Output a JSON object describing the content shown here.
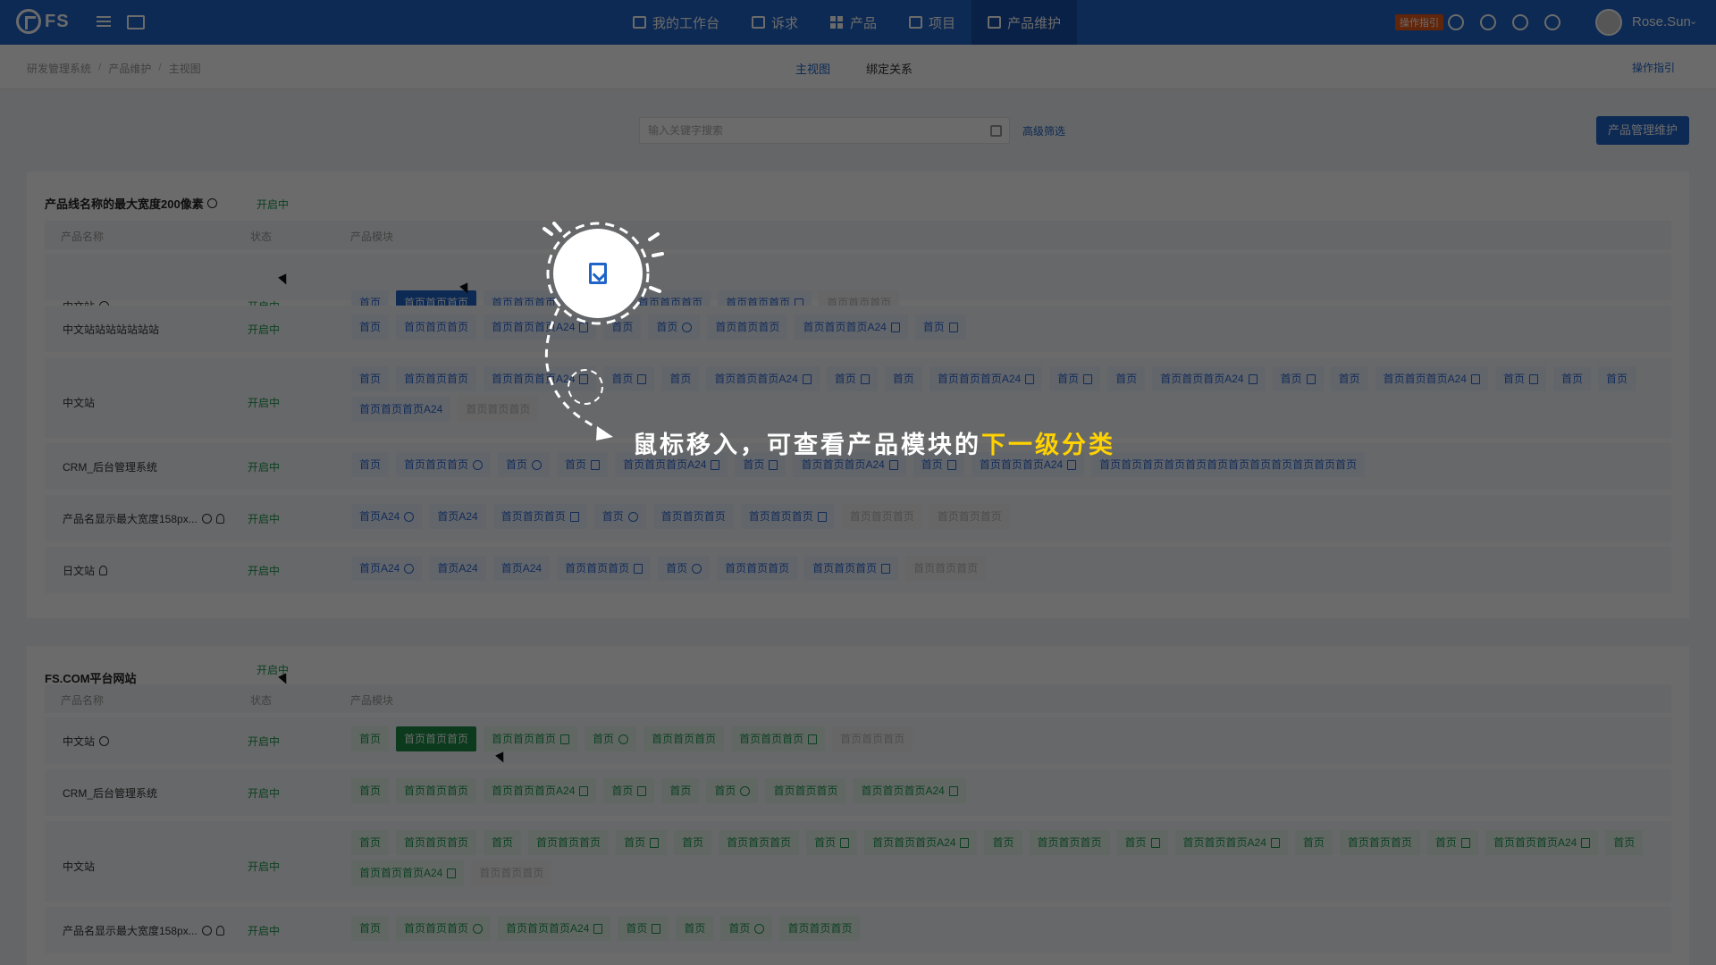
{
  "header": {
    "logo_text": "FS",
    "nav": [
      {
        "label": "我的工作台",
        "icon": "monitor-icon"
      },
      {
        "label": "诉求",
        "icon": "inbox-icon"
      },
      {
        "label": "产品",
        "icon": "grid-icon"
      },
      {
        "label": "项目",
        "icon": "briefcase-icon"
      },
      {
        "label": "产品维护",
        "icon": "plus-square-icon"
      }
    ],
    "guide_badge": "操作指引",
    "user_name": "Rose.Sun",
    "caret": "⌄"
  },
  "subheader": {
    "breadcrumb": [
      "研发管理系统",
      "产品维护",
      "主视图"
    ],
    "view_tabs": [
      "主视图",
      "绑定关系"
    ],
    "op_guide": "操作指引"
  },
  "search": {
    "placeholder": "输入关键字搜索",
    "advanced": "高级筛选",
    "primary_button": "产品管理维护"
  },
  "table_headers": {
    "name": "产品名称",
    "status": "状态",
    "modules": "产品模块"
  },
  "cards": [
    {
      "title": "产品线名称的最大宽度200像素",
      "status": "开启中",
      "rows": [
        {
          "name": "中文站",
          "status": "开启中",
          "modules": [
            "首页",
            "首页首页首页",
            "首页首页首页",
            "首页",
            "首页首页首页",
            "首页首页首页",
            "首页首页首页"
          ]
        },
        {
          "name": "中文站站站站站站站",
          "status": "开启中",
          "modules": [
            "首页",
            "首页首页首页",
            "首页首页首页A24",
            "首页",
            "首页",
            "首页首页首页",
            "首页首页首页A24",
            "首页"
          ]
        },
        {
          "name": "中文站",
          "status": "开启中",
          "modules": [
            "首页",
            "首页首页首页",
            "首页首页首页A24",
            "首页",
            "首页",
            "首页首页首页A24",
            "首页",
            "首页",
            "首页首页首页A24",
            "首页",
            "首页",
            "首页首页首页A24",
            "首页",
            "首页",
            "首页首页首页A24",
            "首页",
            "首页",
            "首页",
            "首页首页首页A24",
            "首页首页首页"
          ]
        },
        {
          "name": "CRM_后台管理系统",
          "status": "开启中",
          "modules": [
            "首页",
            "首页首页首页",
            "首页",
            "首页",
            "首页首页首页A24",
            "首页",
            "首页首页首页A24",
            "首页",
            "首页首页首页A24",
            "首页首页首页首页首页首页首页首页首页首页首页首页"
          ]
        },
        {
          "name": "产品名显示最大宽度158px...",
          "status": "开启中",
          "modules": [
            "首页A24",
            "首页A24",
            "首页首页首页",
            "首页",
            "首页首页首页",
            "首页首页首页",
            "首页首页首页",
            "首页首页首页"
          ]
        },
        {
          "name": "日文站",
          "status": "开启中",
          "modules": [
            "首页A24",
            "首页A24",
            "首页A24",
            "首页首页首页",
            "首页",
            "首页首页首页",
            "首页首页首页",
            "首页首页首页"
          ]
        }
      ]
    },
    {
      "title": "FS.COM平台网站",
      "status": "开启中",
      "rows": [
        {
          "name": "中文站",
          "status": "开启中",
          "modules": [
            "首页",
            "首页首页首页",
            "首页首页首页",
            "首页",
            "首页首页首页",
            "首页首页首页",
            "首页首页首页"
          ]
        },
        {
          "name": "CRM_后台管理系统",
          "status": "开启中",
          "modules": [
            "首页",
            "首页首页首页",
            "首页首页首页A24",
            "首页",
            "首页",
            "首页",
            "首页首页首页",
            "首页首页首页A24"
          ]
        },
        {
          "name": "中文站",
          "status": "开启中",
          "modules": [
            "首页",
            "首页首页首页",
            "首页",
            "首页首页首页",
            "首页",
            "首页",
            "首页首页首页",
            "首页",
            "首页首页首页A24",
            "首页",
            "首页首页首页",
            "首页",
            "首页首页首页A24",
            "首页",
            "首页首页首页",
            "首页",
            "首页首页首页A24",
            "首页",
            "首页首页首页A24",
            "首页首页首页"
          ]
        },
        {
          "name": "产品名显示最大宽度158px...",
          "status": "开启中",
          "modules": [
            "首页",
            "首页首页首页",
            "首页首页首页A24",
            "首页",
            "首页",
            "首页",
            "首页首页首页"
          ]
        }
      ]
    }
  ],
  "overlay": {
    "hint_prefix": "鼠标移入，可查看产品模块的",
    "hint_highlight": "下一级分类"
  }
}
